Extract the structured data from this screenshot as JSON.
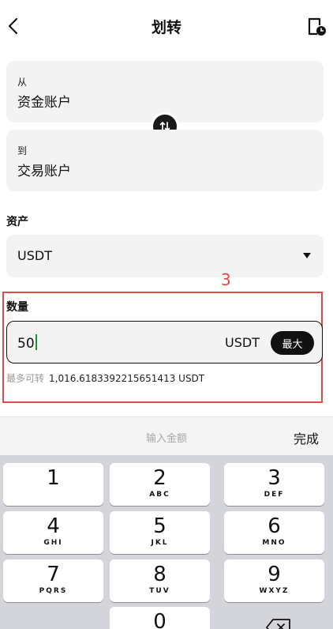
{
  "nav": {
    "title": "划转"
  },
  "from": {
    "label": "从",
    "value": "资金账户"
  },
  "to": {
    "label": "到",
    "value": "交易账户"
  },
  "asset": {
    "label": "资产",
    "selected": "USDT"
  },
  "annotation": {
    "number": "3"
  },
  "quantity": {
    "label": "数量",
    "value": "50",
    "unit": "USDT",
    "max_label": "最大",
    "available_label": "最多可转",
    "available_value": "1,016.6183392215651413 USDT"
  },
  "keyboard": {
    "placeholder": "输入金额",
    "done": "完成",
    "keys": [
      {
        "num": "1",
        "letters": ""
      },
      {
        "num": "2",
        "letters": "ABC"
      },
      {
        "num": "3",
        "letters": "DEF"
      },
      {
        "num": "4",
        "letters": "GHI"
      },
      {
        "num": "5",
        "letters": "JKL"
      },
      {
        "num": "6",
        "letters": "MNO"
      },
      {
        "num": "7",
        "letters": "PQRS"
      },
      {
        "num": "8",
        "letters": "TUV"
      },
      {
        "num": "9",
        "letters": "WXYZ"
      },
      {
        "num": "0",
        "letters": ""
      }
    ]
  },
  "colors": {
    "accent": "#111111",
    "annotation": "#e04a4a",
    "cursor": "#1e8f3b"
  }
}
